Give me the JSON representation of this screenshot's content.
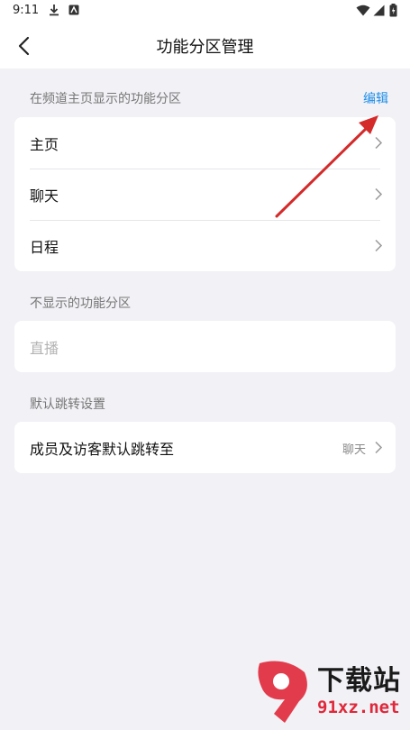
{
  "status_bar": {
    "time": "9:11",
    "icons": [
      "download-icon",
      "app-notification-icon",
      "wifi-icon",
      "signal-icon",
      "battery-icon"
    ]
  },
  "header": {
    "title": "功能分区管理",
    "back_icon": "chevron-left-icon"
  },
  "shown_section": {
    "label": "在频道主页显示的功能分区",
    "edit_label": "编辑",
    "items": [
      {
        "label": "主页"
      },
      {
        "label": "聊天"
      },
      {
        "label": "日程"
      }
    ]
  },
  "hidden_section": {
    "label": "不显示的功能分区",
    "items": [
      {
        "label": "直播"
      }
    ]
  },
  "jump_section": {
    "label": "默认跳转设置",
    "item": {
      "label": "成员及访客默认跳转至",
      "value": "聊天"
    }
  },
  "watermark": {
    "title": "下载站",
    "url": "91xz.net"
  },
  "colors": {
    "accent": "#1e8ee8",
    "background": "#f1f1f6",
    "annotation_arrow": "#d42a2a",
    "watermark_red": "#e0283a"
  }
}
